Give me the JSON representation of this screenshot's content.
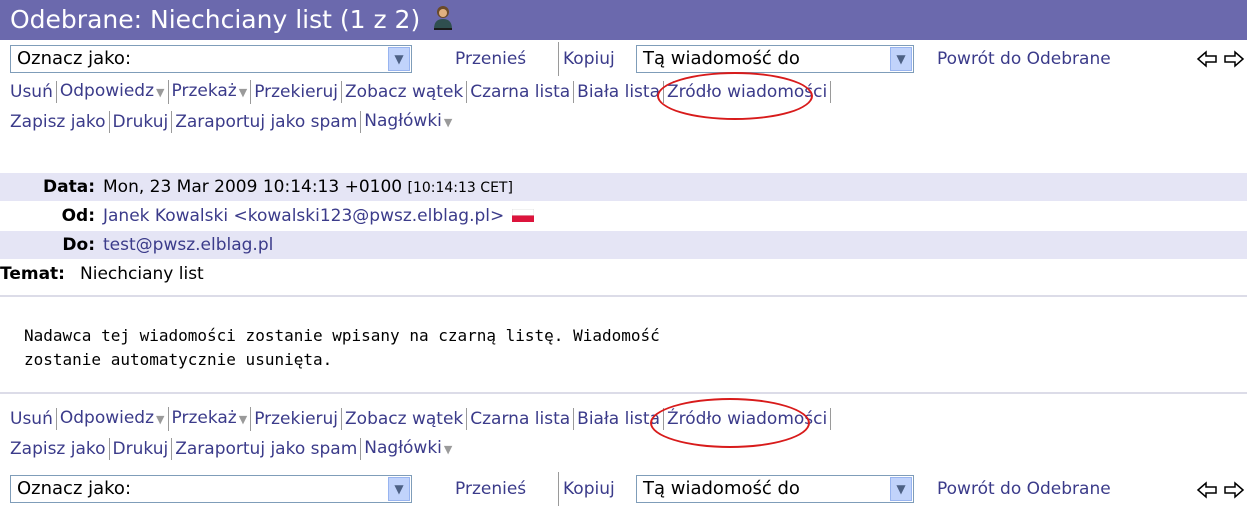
{
  "title": {
    "text": "Odebrane: Niechciany list (1 z 2)",
    "icon": "user-icon"
  },
  "actionbar": {
    "mark_as": "Oznacz jako:",
    "move": "Przenieś",
    "copy": "Kopiuj",
    "target": "Tą wiadomość do",
    "back": "Powrót do Odebrane"
  },
  "toolbar": {
    "delete": "Usuń",
    "reply": "Odpowiedz",
    "forward": "Przekaż",
    "redirect": "Przekieruj",
    "thread": "Zobacz wątek",
    "blacklist": "Czarna lista",
    "whitelist": "Biała lista",
    "source": "Źródło wiadomości",
    "save_as": "Zapisz jako",
    "print": "Drukuj",
    "report_spam": "Zaraportuj jako spam",
    "headers": "Nagłówki"
  },
  "headers": {
    "date_label": "Data:",
    "date_value": "Mon, 23 Mar 2009 10:14:13 +0100",
    "date_local": "[10:14:13 CET]",
    "from_label": "Od:",
    "from_value": "Janek Kowalski <kowalski123@pwsz.elblag.pl>",
    "to_label": "Do:",
    "to_value": "test@pwsz.elblag.pl",
    "subject_label": "Temat:",
    "subject_value": "Niechciany list"
  },
  "message": {
    "line1": "Nadawca tej wiadomości zostanie wpisany na czarną listę. Wiadomość",
    "line2": "zostanie automatycznie usunięta."
  },
  "colors": {
    "titlebar": "#6b69ad",
    "link": "#3b3b8a",
    "highlight_ellipse": "#d81b1b"
  }
}
